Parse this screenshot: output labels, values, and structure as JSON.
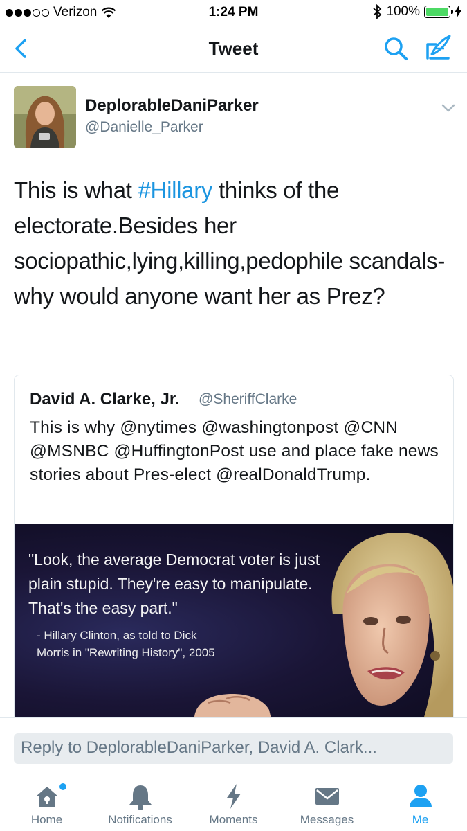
{
  "status_bar": {
    "carrier": "Verizon",
    "time": "1:24 PM",
    "battery": "100%",
    "signal_bars_filled": 3,
    "signal_bars_total": 5
  },
  "nav": {
    "title": "Tweet",
    "back_icon": "chevron-left-icon",
    "search_icon": "search-icon",
    "compose_icon": "compose-icon"
  },
  "tweet": {
    "author_name": "DeplorableDaniParker",
    "author_handle": "@Danielle_Parker",
    "text_before": "This is what ",
    "hashtag": "#Hillary",
    "text_after": " thinks of the electorate.Besides her sociopathic,lying,killing,pedophile scandals-why would anyone want her as Prez?"
  },
  "quoted_tweet": {
    "author_name": "David A. Clarke, Jr.",
    "author_handle": "@SheriffClarke",
    "text": "This is why @nytimes @washingtonpost @CNN @MSNBC @HuffingtonPost use and place fake news stories about Pres-elect @realDonaldTrump.",
    "image_quote": "\"Look, the average Democrat voter is just plain stupid. They're easy to manipulate. That's the easy part.\"",
    "image_attribution": "- Hillary Clinton, as told to Dick Morris in \"Rewriting History\", 2005"
  },
  "reply": {
    "placeholder": "Reply to DeplorableDaniParker, David A. Clark..."
  },
  "tabs": [
    {
      "label": "Home",
      "icon": "home-icon",
      "active": false
    },
    {
      "label": "Notifications",
      "icon": "bell-icon",
      "active": false
    },
    {
      "label": "Moments",
      "icon": "lightning-icon",
      "active": false
    },
    {
      "label": "Messages",
      "icon": "envelope-icon",
      "active": false
    },
    {
      "label": "Me",
      "icon": "person-icon",
      "active": true
    }
  ],
  "colors": {
    "accent": "#1da1f2",
    "hashtag": "#1b95e0",
    "muted": "#657786",
    "battery": "#4cd964"
  }
}
